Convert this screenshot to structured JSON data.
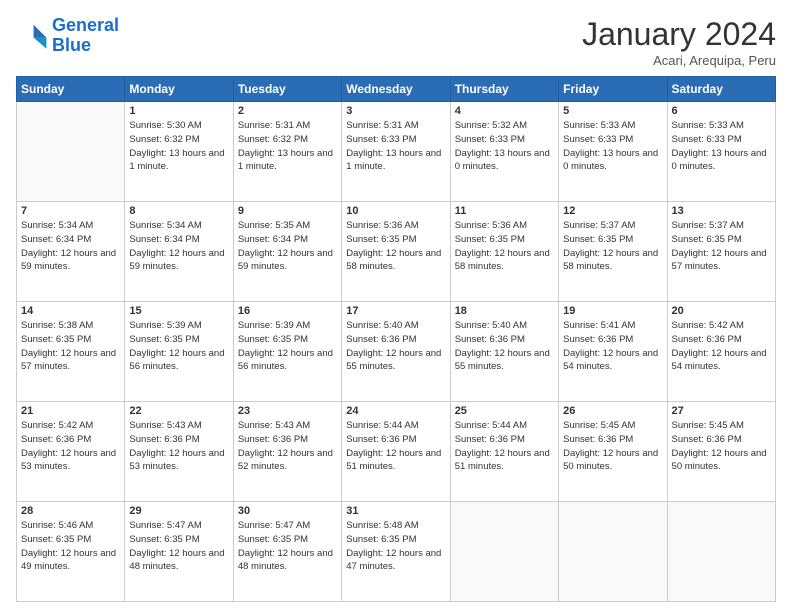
{
  "logo": {
    "line1": "General",
    "line2": "Blue"
  },
  "title": "January 2024",
  "subtitle": "Acari, Arequipa, Peru",
  "weekdays": [
    "Sunday",
    "Monday",
    "Tuesday",
    "Wednesday",
    "Thursday",
    "Friday",
    "Saturday"
  ],
  "weeks": [
    [
      {
        "day": "",
        "sunrise": "",
        "sunset": "",
        "daylight": "",
        "empty": true
      },
      {
        "day": "1",
        "sunrise": "Sunrise: 5:30 AM",
        "sunset": "Sunset: 6:32 PM",
        "daylight": "Daylight: 13 hours and 1 minute."
      },
      {
        "day": "2",
        "sunrise": "Sunrise: 5:31 AM",
        "sunset": "Sunset: 6:32 PM",
        "daylight": "Daylight: 13 hours and 1 minute."
      },
      {
        "day": "3",
        "sunrise": "Sunrise: 5:31 AM",
        "sunset": "Sunset: 6:33 PM",
        "daylight": "Daylight: 13 hours and 1 minute."
      },
      {
        "day": "4",
        "sunrise": "Sunrise: 5:32 AM",
        "sunset": "Sunset: 6:33 PM",
        "daylight": "Daylight: 13 hours and 0 minutes."
      },
      {
        "day": "5",
        "sunrise": "Sunrise: 5:33 AM",
        "sunset": "Sunset: 6:33 PM",
        "daylight": "Daylight: 13 hours and 0 minutes."
      },
      {
        "day": "6",
        "sunrise": "Sunrise: 5:33 AM",
        "sunset": "Sunset: 6:33 PM",
        "daylight": "Daylight: 13 hours and 0 minutes."
      }
    ],
    [
      {
        "day": "7",
        "sunrise": "Sunrise: 5:34 AM",
        "sunset": "Sunset: 6:34 PM",
        "daylight": "Daylight: 12 hours and 59 minutes."
      },
      {
        "day": "8",
        "sunrise": "Sunrise: 5:34 AM",
        "sunset": "Sunset: 6:34 PM",
        "daylight": "Daylight: 12 hours and 59 minutes."
      },
      {
        "day": "9",
        "sunrise": "Sunrise: 5:35 AM",
        "sunset": "Sunset: 6:34 PM",
        "daylight": "Daylight: 12 hours and 59 minutes."
      },
      {
        "day": "10",
        "sunrise": "Sunrise: 5:36 AM",
        "sunset": "Sunset: 6:35 PM",
        "daylight": "Daylight: 12 hours and 58 minutes."
      },
      {
        "day": "11",
        "sunrise": "Sunrise: 5:36 AM",
        "sunset": "Sunset: 6:35 PM",
        "daylight": "Daylight: 12 hours and 58 minutes."
      },
      {
        "day": "12",
        "sunrise": "Sunrise: 5:37 AM",
        "sunset": "Sunset: 6:35 PM",
        "daylight": "Daylight: 12 hours and 58 minutes."
      },
      {
        "day": "13",
        "sunrise": "Sunrise: 5:37 AM",
        "sunset": "Sunset: 6:35 PM",
        "daylight": "Daylight: 12 hours and 57 minutes."
      }
    ],
    [
      {
        "day": "14",
        "sunrise": "Sunrise: 5:38 AM",
        "sunset": "Sunset: 6:35 PM",
        "daylight": "Daylight: 12 hours and 57 minutes."
      },
      {
        "day": "15",
        "sunrise": "Sunrise: 5:39 AM",
        "sunset": "Sunset: 6:35 PM",
        "daylight": "Daylight: 12 hours and 56 minutes."
      },
      {
        "day": "16",
        "sunrise": "Sunrise: 5:39 AM",
        "sunset": "Sunset: 6:35 PM",
        "daylight": "Daylight: 12 hours and 56 minutes."
      },
      {
        "day": "17",
        "sunrise": "Sunrise: 5:40 AM",
        "sunset": "Sunset: 6:36 PM",
        "daylight": "Daylight: 12 hours and 55 minutes."
      },
      {
        "day": "18",
        "sunrise": "Sunrise: 5:40 AM",
        "sunset": "Sunset: 6:36 PM",
        "daylight": "Daylight: 12 hours and 55 minutes."
      },
      {
        "day": "19",
        "sunrise": "Sunrise: 5:41 AM",
        "sunset": "Sunset: 6:36 PM",
        "daylight": "Daylight: 12 hours and 54 minutes."
      },
      {
        "day": "20",
        "sunrise": "Sunrise: 5:42 AM",
        "sunset": "Sunset: 6:36 PM",
        "daylight": "Daylight: 12 hours and 54 minutes."
      }
    ],
    [
      {
        "day": "21",
        "sunrise": "Sunrise: 5:42 AM",
        "sunset": "Sunset: 6:36 PM",
        "daylight": "Daylight: 12 hours and 53 minutes."
      },
      {
        "day": "22",
        "sunrise": "Sunrise: 5:43 AM",
        "sunset": "Sunset: 6:36 PM",
        "daylight": "Daylight: 12 hours and 53 minutes."
      },
      {
        "day": "23",
        "sunrise": "Sunrise: 5:43 AM",
        "sunset": "Sunset: 6:36 PM",
        "daylight": "Daylight: 12 hours and 52 minutes."
      },
      {
        "day": "24",
        "sunrise": "Sunrise: 5:44 AM",
        "sunset": "Sunset: 6:36 PM",
        "daylight": "Daylight: 12 hours and 51 minutes."
      },
      {
        "day": "25",
        "sunrise": "Sunrise: 5:44 AM",
        "sunset": "Sunset: 6:36 PM",
        "daylight": "Daylight: 12 hours and 51 minutes."
      },
      {
        "day": "26",
        "sunrise": "Sunrise: 5:45 AM",
        "sunset": "Sunset: 6:36 PM",
        "daylight": "Daylight: 12 hours and 50 minutes."
      },
      {
        "day": "27",
        "sunrise": "Sunrise: 5:45 AM",
        "sunset": "Sunset: 6:36 PM",
        "daylight": "Daylight: 12 hours and 50 minutes."
      }
    ],
    [
      {
        "day": "28",
        "sunrise": "Sunrise: 5:46 AM",
        "sunset": "Sunset: 6:35 PM",
        "daylight": "Daylight: 12 hours and 49 minutes."
      },
      {
        "day": "29",
        "sunrise": "Sunrise: 5:47 AM",
        "sunset": "Sunset: 6:35 PM",
        "daylight": "Daylight: 12 hours and 48 minutes."
      },
      {
        "day": "30",
        "sunrise": "Sunrise: 5:47 AM",
        "sunset": "Sunset: 6:35 PM",
        "daylight": "Daylight: 12 hours and 48 minutes."
      },
      {
        "day": "31",
        "sunrise": "Sunrise: 5:48 AM",
        "sunset": "Sunset: 6:35 PM",
        "daylight": "Daylight: 12 hours and 47 minutes."
      },
      {
        "day": "",
        "sunrise": "",
        "sunset": "",
        "daylight": "",
        "empty": true
      },
      {
        "day": "",
        "sunrise": "",
        "sunset": "",
        "daylight": "",
        "empty": true
      },
      {
        "day": "",
        "sunrise": "",
        "sunset": "",
        "daylight": "",
        "empty": true
      }
    ]
  ]
}
